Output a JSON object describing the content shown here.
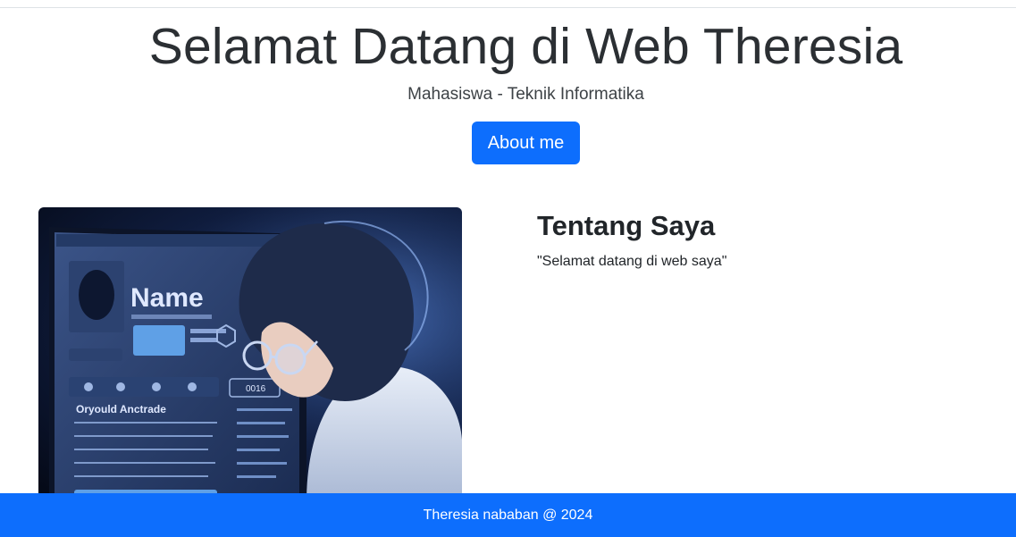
{
  "hero": {
    "title": "Selamat Datang di Web Theresia",
    "subtitle": "Mahasiswa - Teknik Informatika",
    "button_label": "About me"
  },
  "about": {
    "heading": "Tentang Saya",
    "quote": "\"Selamat datang di web saya\"",
    "image": {
      "screen_name": "Name",
      "screen_section": "Oryould Anctrade",
      "screen_value": "0016"
    }
  },
  "footer": {
    "text": "Theresia nababan @ 2024"
  },
  "colors": {
    "primary": "#0d6efd",
    "text": "#212529"
  }
}
